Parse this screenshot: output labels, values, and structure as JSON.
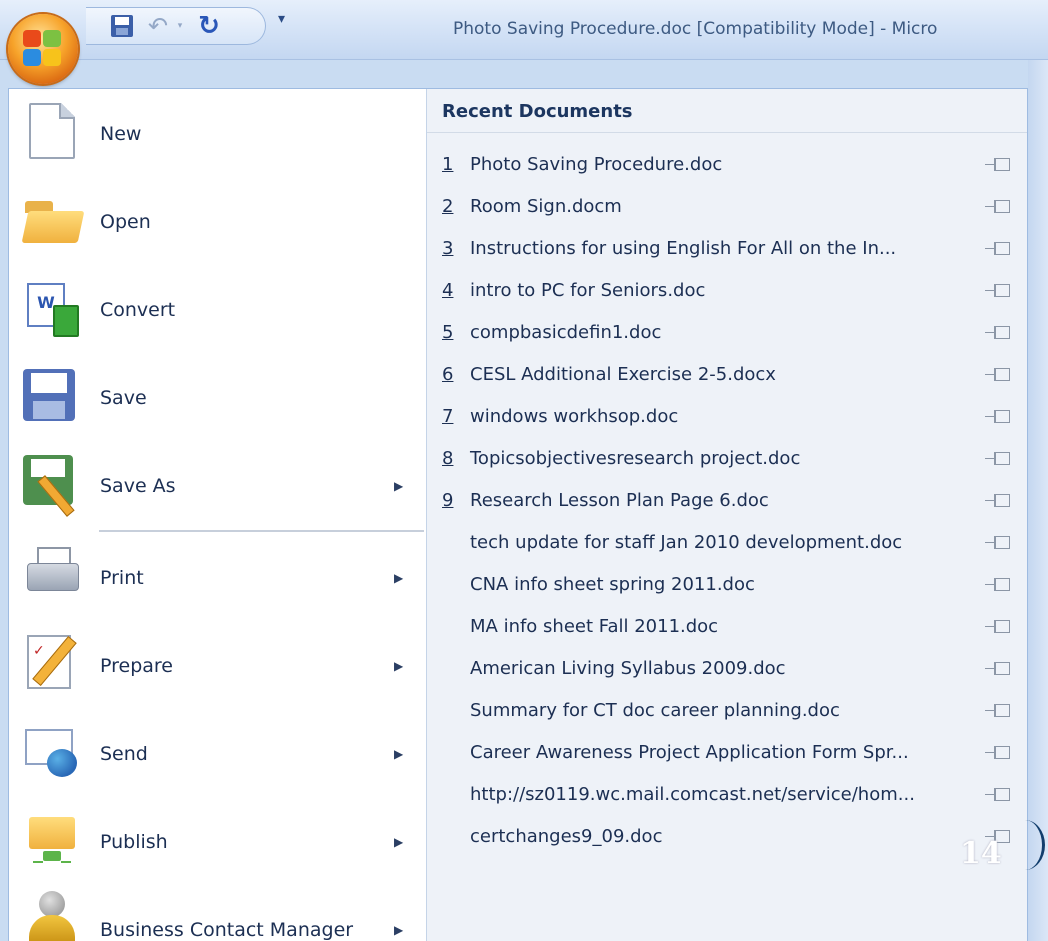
{
  "window": {
    "title": "Photo Saving Procedure.doc [Compatibility Mode] - Micro"
  },
  "quick_access": {
    "save": "save-icon",
    "undo": "undo-icon",
    "redo": "redo-icon",
    "customize": "▾"
  },
  "menu": {
    "items": [
      {
        "label": "New",
        "has_submenu": false
      },
      {
        "label": "Open",
        "has_submenu": false
      },
      {
        "label": "Convert",
        "has_submenu": false
      },
      {
        "label": "Save",
        "has_submenu": false
      },
      {
        "label": "Save As",
        "has_submenu": true
      },
      {
        "label": "Print",
        "has_submenu": true
      },
      {
        "label": "Prepare",
        "has_submenu": true
      },
      {
        "label": "Send",
        "has_submenu": true
      },
      {
        "label": "Publish",
        "has_submenu": true
      },
      {
        "label": "Business Contact Manager",
        "has_submenu": true
      }
    ],
    "submenu_arrow": "▶"
  },
  "recent": {
    "header": "Recent Documents",
    "documents": [
      {
        "num": "1",
        "name": "Photo Saving Procedure.doc"
      },
      {
        "num": "2",
        "name": "Room Sign.docm"
      },
      {
        "num": "3",
        "name": "Instructions for using English For All on the In..."
      },
      {
        "num": "4",
        "name": "intro to PC for Seniors.doc"
      },
      {
        "num": "5",
        "name": "compbasicdefin1.doc"
      },
      {
        "num": "6",
        "name": "CESL Additional Exercise 2-5.docx"
      },
      {
        "num": "7",
        "name": "windows workhsop.doc"
      },
      {
        "num": "8",
        "name": "Topicsobjectivesresearch project.doc"
      },
      {
        "num": "9",
        "name": "Research Lesson Plan Page 6.doc"
      },
      {
        "num": "",
        "name": "tech update for staff Jan 2010 development.doc"
      },
      {
        "num": "",
        "name": "CNA info sheet spring 2011.doc"
      },
      {
        "num": "",
        "name": "MA info sheet Fall 2011.doc"
      },
      {
        "num": "",
        "name": "American Living Syllabus 2009.doc"
      },
      {
        "num": "",
        "name": "Summary for CT doc career planning.doc"
      },
      {
        "num": "",
        "name": "Career Awareness Project Application Form Spr..."
      },
      {
        "num": "",
        "name": "http://sz0119.wc.mail.comcast.net/service/hom..."
      },
      {
        "num": "",
        "name": "certchanges9_09.doc"
      }
    ]
  },
  "slide_number": "14"
}
